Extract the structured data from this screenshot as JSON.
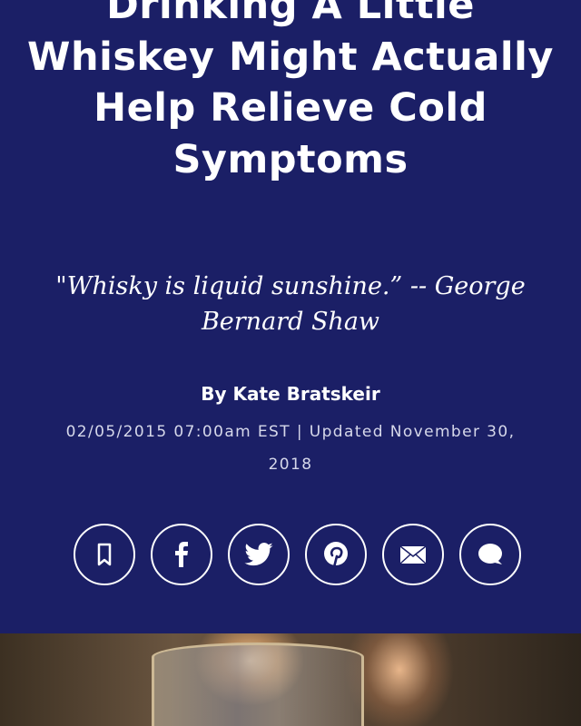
{
  "article": {
    "title": "Drinking A Little Whiskey Might Actually Help Relieve Cold Symptoms",
    "quote": "\"Whisky is liquid sunshine.” -- George Bernard Shaw",
    "byline": "By Kate Bratskeir",
    "date": "02/05/2015 07:00am EST | Updated November 30, 2018"
  },
  "share": [
    {
      "icon": "bookmark-icon"
    },
    {
      "icon": "facebook-icon"
    },
    {
      "icon": "twitter-icon"
    },
    {
      "icon": "pinterest-icon"
    },
    {
      "icon": "email-icon"
    },
    {
      "icon": "comment-icon"
    }
  ],
  "colors": {
    "background": "#1b1f66",
    "text": "#ffffff"
  }
}
